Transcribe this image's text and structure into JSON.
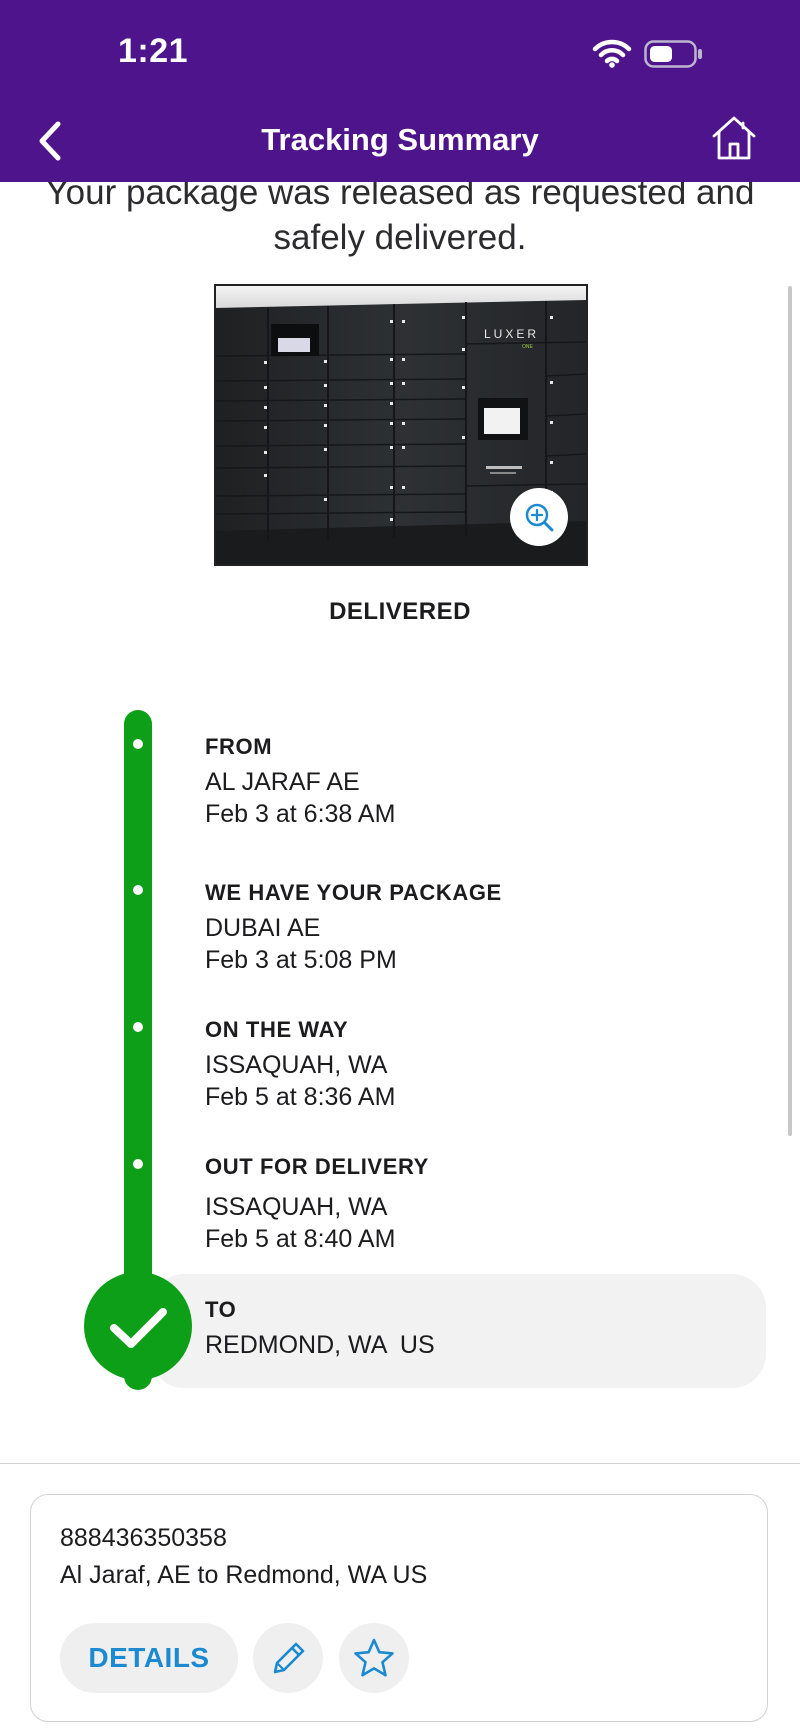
{
  "status_bar": {
    "time": "1:21"
  },
  "nav": {
    "title": "Tracking Summary"
  },
  "message": {
    "line1": "Your package was released as requested and",
    "line2": "safely delivered."
  },
  "photo": {
    "brand_text": "LUXER",
    "brand_sub": "ONE"
  },
  "delivery_status": "DELIVERED",
  "timeline": [
    {
      "heading": "FROM",
      "location": "AL JARAF AE",
      "time": "Feb 3 at 6:38 AM"
    },
    {
      "heading": "WE HAVE YOUR PACKAGE",
      "location": "DUBAI AE",
      "time": "Feb 3 at 5:08 PM"
    },
    {
      "heading": "ON THE WAY",
      "location": "ISSAQUAH, WA",
      "time": "Feb 5 at 8:36 AM"
    },
    {
      "heading": "OUT FOR DELIVERY",
      "location": "ISSAQUAH, WA",
      "time": "Feb 5 at 8:40 AM"
    },
    {
      "heading": "TO",
      "location": "REDMOND, WA  US"
    }
  ],
  "card": {
    "tracking_number": "888436350358",
    "route": "Al Jaraf, AE to Redmond, WA US",
    "details_label": "DETAILS"
  },
  "colors": {
    "header": "#4d148c",
    "progress_green": "#0c9f17",
    "link_blue": "#1c8ad0"
  },
  "icons": [
    "wifi-icon",
    "battery-icon",
    "back-chevron-icon",
    "home-icon",
    "zoom-in-icon",
    "checkmark-icon",
    "pencil-icon",
    "star-icon"
  ]
}
